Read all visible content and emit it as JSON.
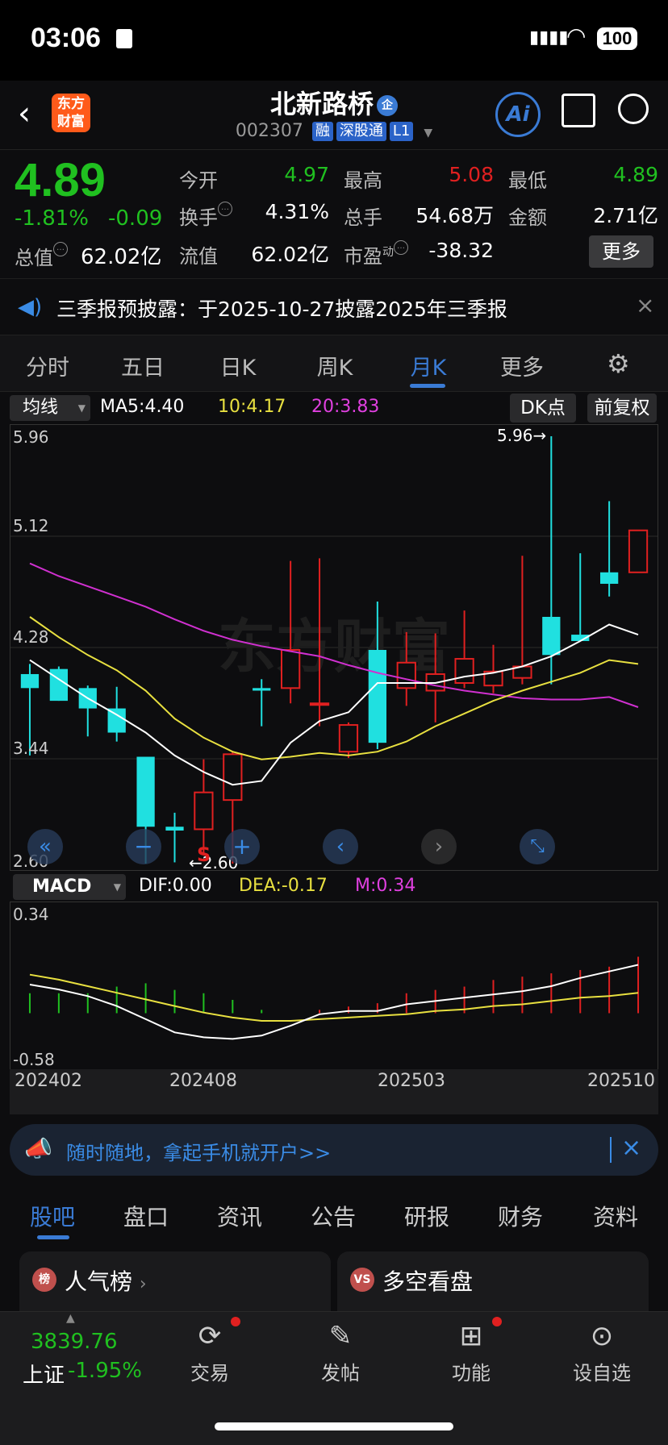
{
  "status": {
    "time": "03:06",
    "battery": "100"
  },
  "header": {
    "logo": "东方财富",
    "name": "北新路桥",
    "name_badge": "企",
    "code": "002307",
    "tags": [
      "融",
      "深股通",
      "L1"
    ],
    "ai": "Ai"
  },
  "quote": {
    "price": "4.89",
    "change_pct": "-1.81%",
    "change": "-0.09",
    "open_label": "今开",
    "open": "4.97",
    "high_label": "最高",
    "high": "5.08",
    "low_label": "最低",
    "low": "4.89",
    "turnover_label": "换手",
    "turnover": "4.31%",
    "volume_label": "总手",
    "volume": "54.68万",
    "amount_label": "金额",
    "amount": "2.71亿",
    "total_mv_label": "总值",
    "total_mv": "62.02亿",
    "float_mv_label": "流值",
    "float_mv": "62.02亿",
    "pe_label": "市盈",
    "pe_sup": "动",
    "pe": "-38.32",
    "more": "更多"
  },
  "notice": {
    "text": "三季报预披露：于2025-10-27披露2025年三季报",
    "close": "×"
  },
  "tabs": [
    "分时",
    "五日",
    "日K",
    "周K",
    "月K",
    "更多"
  ],
  "indicator": {
    "select": "均线",
    "ma5": "MA5:4.40",
    "ma10": "10:4.17",
    "ma20": "20:3.83",
    "dk": "DK点",
    "fq": "前复权",
    "colors": {
      "ma5": "#ffffff",
      "ma10": "#e8e040",
      "ma20": "#d030d0"
    }
  },
  "kline": {
    "y_labels": [
      "5.96",
      "5.12",
      "4.28",
      "3.44",
      "2.60"
    ],
    "max_label": "5.96",
    "min_label": "2.60",
    "watermark": "东方财富"
  },
  "macd": {
    "select": "MACD",
    "dif": "DIF:0.00",
    "dea": "DEA:-0.17",
    "m": "M:0.34",
    "y_top": "0.34",
    "y_bottom": "-0.58"
  },
  "x_axis": [
    "202402",
    "202408",
    "202503",
    "202510"
  ],
  "chart_data": {
    "type": "candlestick",
    "title": "",
    "x": [
      "202401",
      "202402",
      "202403",
      "202404",
      "202405",
      "202406",
      "202407",
      "202408",
      "202409",
      "202410",
      "202411",
      "202412",
      "202501",
      "202502",
      "202503",
      "202504",
      "202505",
      "202506",
      "202507",
      "202508",
      "202509",
      "202510"
    ],
    "open": [
      4.09,
      4.13,
      3.98,
      3.82,
      3.44,
      2.89,
      2.87,
      3.1,
      3.98,
      3.98,
      3.86,
      3.48,
      4.28,
      3.98,
      3.96,
      4.02,
      4.0,
      4.06,
      4.54,
      4.4,
      4.89,
      4.89
    ],
    "close": [
      3.98,
      3.88,
      3.82,
      3.63,
      2.89,
      2.86,
      3.16,
      3.46,
      3.96,
      4.28,
      3.86,
      3.69,
      3.55,
      4.18,
      4.09,
      4.21,
      4.11,
      4.15,
      4.24,
      4.35,
      4.8,
      5.22
    ],
    "high": [
      4.17,
      4.15,
      4.0,
      3.99,
      3.44,
      3.0,
      3.42,
      3.48,
      4.05,
      4.98,
      5.0,
      3.71,
      4.66,
      4.42,
      4.41,
      4.59,
      4.32,
      5.02,
      5.96,
      5.04,
      5.45,
      5.08
    ],
    "low": [
      3.45,
      3.88,
      3.6,
      3.56,
      2.6,
      2.61,
      2.67,
      2.6,
      3.68,
      3.86,
      3.68,
      3.43,
      3.5,
      3.84,
      3.71,
      3.98,
      3.94,
      4.01,
      4.01,
      4.38,
      4.7,
      4.89
    ],
    "ma5": [
      4.2,
      4.05,
      3.9,
      3.77,
      3.63,
      3.45,
      3.32,
      3.22,
      3.25,
      3.55,
      3.72,
      3.79,
      4.02,
      4.02,
      4.02,
      4.07,
      4.1,
      4.15,
      4.23,
      4.35,
      4.48,
      4.4
    ],
    "ma10": [
      4.54,
      4.38,
      4.24,
      4.12,
      3.96,
      3.74,
      3.59,
      3.48,
      3.42,
      3.44,
      3.47,
      3.45,
      3.48,
      3.56,
      3.68,
      3.78,
      3.88,
      3.96,
      4.03,
      4.1,
      4.2,
      4.17
    ],
    "ma20": [
      4.96,
      4.86,
      4.78,
      4.7,
      4.62,
      4.52,
      4.43,
      4.36,
      4.31,
      4.27,
      4.23,
      4.16,
      4.1,
      4.05,
      4.0,
      3.96,
      3.93,
      3.9,
      3.89,
      3.89,
      3.91,
      3.83
    ],
    "ylim": [
      2.6,
      5.96
    ],
    "macd_dif": [
      -0.12,
      -0.15,
      -0.19,
      -0.25,
      -0.33,
      -0.41,
      -0.44,
      -0.45,
      -0.43,
      -0.37,
      -0.3,
      -0.28,
      -0.28,
      -0.24,
      -0.22,
      -0.2,
      -0.18,
      -0.16,
      -0.13,
      -0.08,
      -0.04,
      0.0
    ],
    "macd_dea": [
      -0.06,
      -0.09,
      -0.13,
      -0.17,
      -0.21,
      -0.25,
      -0.29,
      -0.32,
      -0.34,
      -0.34,
      -0.33,
      -0.32,
      -0.31,
      -0.3,
      -0.28,
      -0.27,
      -0.25,
      -0.24,
      -0.22,
      -0.2,
      -0.19,
      -0.17
    ],
    "macd_m": [
      -0.12,
      -0.12,
      -0.12,
      -0.16,
      -0.18,
      -0.14,
      -0.12,
      -0.08,
      -0.02,
      0.0,
      0.02,
      0.04,
      0.06,
      0.12,
      0.14,
      0.16,
      0.2,
      0.22,
      0.24,
      0.26,
      0.28,
      0.34
    ],
    "macd_ylim": [
      -0.58,
      0.34
    ]
  },
  "banner": {
    "text": "随时随地，拿起手机就开户>>",
    "close": "×"
  },
  "content_tabs": [
    "股吧",
    "盘口",
    "资讯",
    "公告",
    "研报",
    "财务",
    "资料"
  ],
  "cards": [
    {
      "icon": "榜",
      "title": "人气榜"
    },
    {
      "icon": "VS",
      "title": "多空看盘"
    }
  ],
  "bottom": {
    "index_value": "3839.76",
    "index_name": "上证",
    "index_change": "-1.95%",
    "items": [
      "交易",
      "发帖",
      "功能",
      "设自选"
    ]
  }
}
